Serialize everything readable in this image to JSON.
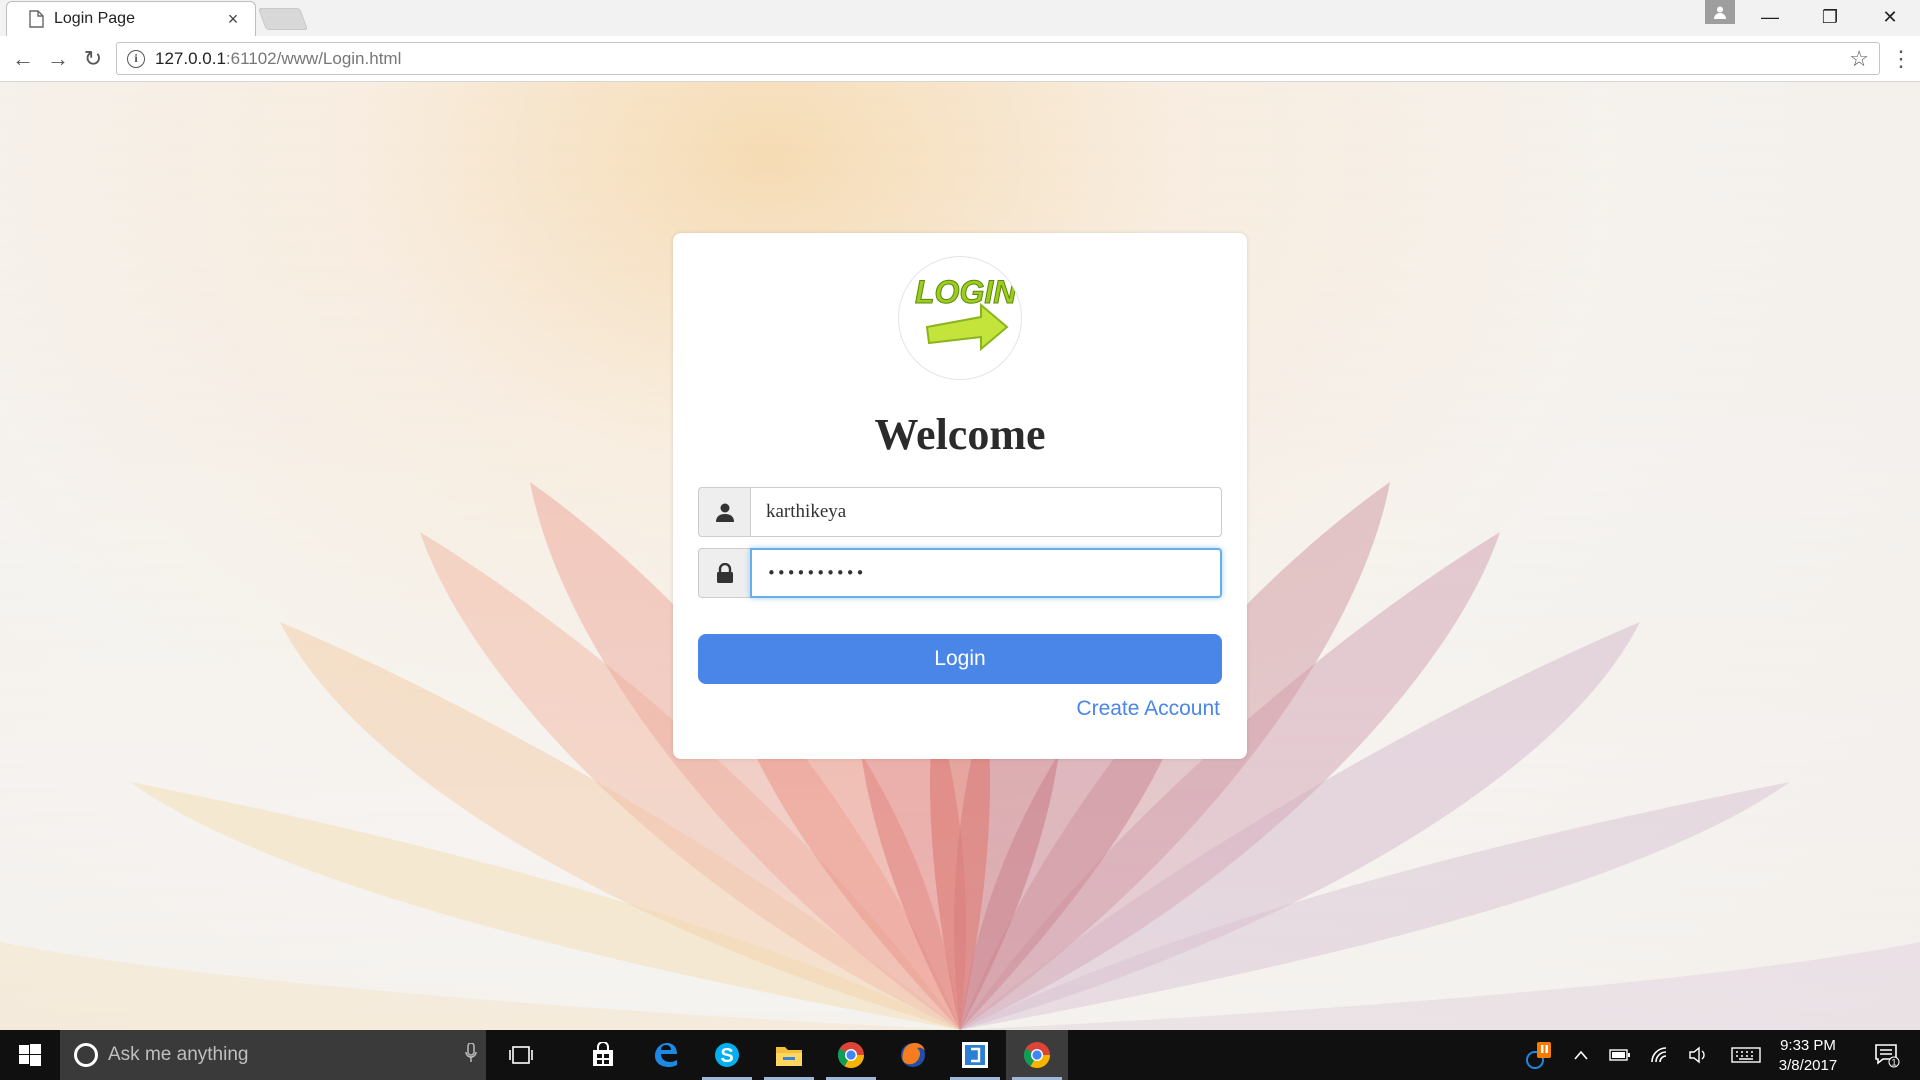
{
  "browser": {
    "tab_title": "Login Page",
    "tab_close": "×",
    "url_host": "127.0.0.1",
    "url_rest": ":61102/www/Login.html",
    "window_controls": {
      "minimize": "—",
      "restore": "❐",
      "close": "✕"
    },
    "nav": {
      "back": "←",
      "forward": "→",
      "reload": "↻"
    },
    "star": "☆",
    "menu": "⋮",
    "info": "i"
  },
  "login": {
    "logo_text": "LOGIN",
    "heading": "Welcome",
    "username_value": "karthikeya",
    "password_value": "••••••••••",
    "login_button": "Login",
    "create_account": "Create Account"
  },
  "taskbar": {
    "search_placeholder": "Ask me anything",
    "time": "9:33 PM",
    "date": "3/8/2017",
    "notification_count": "1"
  },
  "colors": {
    "accent": "#4a86e8",
    "focus_border": "#66afe9",
    "taskbar": "#101010"
  }
}
